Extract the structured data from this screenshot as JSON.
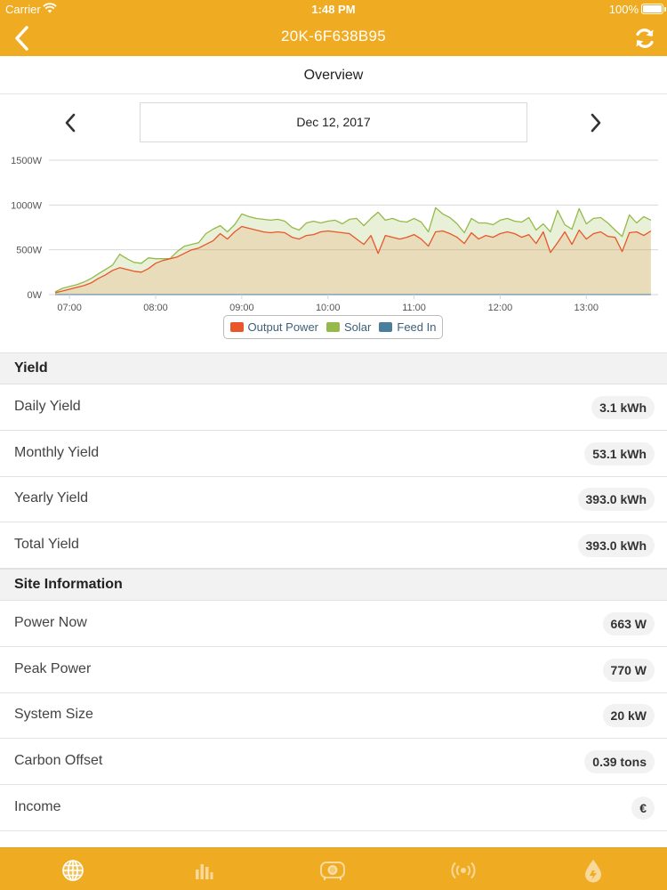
{
  "status_bar": {
    "carrier": "Carrier",
    "time": "1:48 PM",
    "battery": "100%"
  },
  "nav": {
    "title": "20K-6F638B95",
    "back_icon": "chevron-left-icon",
    "refresh_icon": "refresh-icon"
  },
  "page": {
    "tab_title": "Overview",
    "date": "Dec 12, 2017"
  },
  "colors": {
    "brand": "#efac22",
    "output_power": "#e8562a",
    "solar": "#95b94a",
    "feed_in": "#4a7f9c"
  },
  "chart_data": {
    "type": "area",
    "title": "",
    "xlabel": "",
    "ylabel": "",
    "y_ticks": [
      "1500W",
      "1000W",
      "500W",
      "0W"
    ],
    "ylim": [
      0,
      1500
    ],
    "x_ticks": [
      "07:00",
      "08:00",
      "09:00",
      "10:00",
      "11:00",
      "12:00",
      "13:00"
    ],
    "x_range": [
      "06:50",
      "13:50"
    ],
    "grid": true,
    "legend_position": "bottom-center",
    "x": [
      "06:50",
      "06:55",
      "07:00",
      "07:05",
      "07:10",
      "07:15",
      "07:20",
      "07:25",
      "07:30",
      "07:35",
      "07:40",
      "07:45",
      "07:50",
      "07:55",
      "08:00",
      "08:05",
      "08:10",
      "08:15",
      "08:20",
      "08:25",
      "08:30",
      "08:35",
      "08:40",
      "08:45",
      "08:50",
      "08:55",
      "09:00",
      "09:05",
      "09:10",
      "09:15",
      "09:20",
      "09:25",
      "09:30",
      "09:35",
      "09:40",
      "09:45",
      "09:50",
      "09:55",
      "10:00",
      "10:05",
      "10:10",
      "10:15",
      "10:20",
      "10:25",
      "10:30",
      "10:35",
      "10:40",
      "10:45",
      "10:50",
      "10:55",
      "11:00",
      "11:05",
      "11:10",
      "11:15",
      "11:20",
      "11:25",
      "11:30",
      "11:35",
      "11:40",
      "11:45",
      "11:50",
      "11:55",
      "12:00",
      "12:05",
      "12:10",
      "12:15",
      "12:20",
      "12:25",
      "12:30",
      "12:35",
      "12:40",
      "12:45",
      "12:50",
      "12:55",
      "13:00",
      "13:05",
      "13:10",
      "13:15",
      "13:20",
      "13:25",
      "13:30",
      "13:35",
      "13:40",
      "13:45"
    ],
    "series": [
      {
        "name": "Output Power",
        "values": [
          20,
          40,
          60,
          80,
          100,
          130,
          180,
          220,
          270,
          300,
          280,
          260,
          250,
          290,
          350,
          380,
          400,
          420,
          460,
          500,
          520,
          560,
          600,
          680,
          620,
          700,
          760,
          740,
          720,
          700,
          690,
          700,
          690,
          640,
          620,
          660,
          670,
          700,
          710,
          700,
          690,
          680,
          620,
          560,
          660,
          460,
          660,
          640,
          620,
          640,
          670,
          620,
          540,
          700,
          710,
          680,
          640,
          570,
          690,
          620,
          660,
          640,
          680,
          700,
          680,
          640,
          670,
          570,
          700,
          470,
          580,
          700,
          560,
          720,
          620,
          680,
          700,
          650,
          640,
          480,
          690,
          700,
          660,
          710
        ]
      },
      {
        "name": "Solar",
        "values": [
          30,
          70,
          90,
          110,
          140,
          180,
          230,
          280,
          330,
          450,
          400,
          360,
          350,
          410,
          400,
          400,
          400,
          480,
          540,
          560,
          580,
          680,
          730,
          770,
          700,
          780,
          900,
          870,
          850,
          840,
          830,
          840,
          820,
          750,
          720,
          800,
          820,
          800,
          820,
          830,
          790,
          840,
          850,
          770,
          850,
          920,
          830,
          850,
          820,
          810,
          850,
          810,
          700,
          970,
          900,
          860,
          790,
          690,
          850,
          800,
          800,
          780,
          830,
          850,
          820,
          810,
          860,
          720,
          790,
          700,
          940,
          780,
          730,
          960,
          790,
          850,
          860,
          800,
          720,
          650,
          890,
          800,
          870,
          830
        ]
      },
      {
        "name": "Feed In",
        "values": [
          0,
          0,
          0,
          0,
          0,
          0,
          0,
          0,
          0,
          0,
          0,
          0,
          0,
          0,
          0,
          0,
          0,
          0,
          0,
          0,
          0,
          0,
          0,
          0,
          0,
          0,
          0,
          0,
          0,
          0,
          0,
          0,
          0,
          0,
          0,
          0,
          0,
          0,
          0,
          0,
          0,
          0,
          0,
          0,
          0,
          0,
          0,
          0,
          0,
          0,
          0,
          0,
          0,
          0,
          0,
          0,
          0,
          0,
          0,
          0,
          0,
          0,
          0,
          0,
          0,
          0,
          0,
          0,
          0,
          0,
          0,
          0,
          0,
          0,
          0,
          0,
          0,
          0,
          0,
          0,
          0,
          0,
          0,
          0
        ]
      }
    ]
  },
  "yield": {
    "header": "Yield",
    "rows": [
      {
        "label": "Daily Yield",
        "value": "3.1 kWh"
      },
      {
        "label": "Monthly Yield",
        "value": "53.1 kWh"
      },
      {
        "label": "Yearly Yield",
        "value": "393.0 kWh"
      },
      {
        "label": "Total Yield",
        "value": "393.0 kWh"
      }
    ]
  },
  "site": {
    "header": "Site Information",
    "rows": [
      {
        "label": "Power Now",
        "value": "663 W"
      },
      {
        "label": "Peak Power",
        "value": "770 W"
      },
      {
        "label": "System Size",
        "value": "20 kW"
      },
      {
        "label": "Carbon Offset",
        "value": "0.39 tons"
      },
      {
        "label": "Income",
        "value": "€"
      }
    ]
  },
  "tabs": [
    {
      "icon": "globe-icon"
    },
    {
      "icon": "bar-chart-icon"
    },
    {
      "icon": "inverter-icon"
    },
    {
      "icon": "broadcast-icon"
    },
    {
      "icon": "droplet-icon"
    }
  ]
}
